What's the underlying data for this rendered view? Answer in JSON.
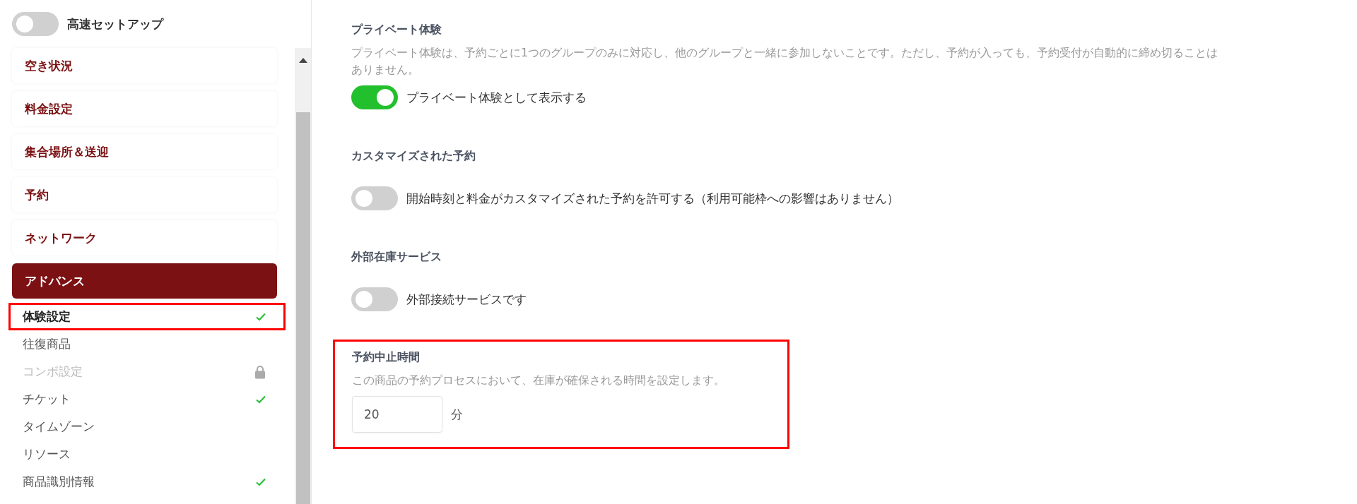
{
  "quick_setup": {
    "label": "高速セットアップ",
    "on": false
  },
  "nav": [
    {
      "label": "空き状況",
      "selected": false
    },
    {
      "label": "料金設定",
      "selected": false
    },
    {
      "label": "集合場所＆送迎",
      "selected": false
    },
    {
      "label": "予約",
      "selected": false
    },
    {
      "label": "ネットワーク",
      "selected": false
    },
    {
      "label": "アドバンス",
      "selected": true
    }
  ],
  "sub_items": [
    {
      "label": "体験設定",
      "selected": true,
      "checked": true,
      "locked": false,
      "highlighted": true
    },
    {
      "label": "往復商品",
      "selected": false,
      "checked": false,
      "locked": false,
      "highlighted": false
    },
    {
      "label": "コンボ設定",
      "selected": false,
      "checked": false,
      "locked": true,
      "highlighted": false
    },
    {
      "label": "チケット",
      "selected": false,
      "checked": true,
      "locked": false,
      "highlighted": false
    },
    {
      "label": "タイムゾーン",
      "selected": false,
      "checked": false,
      "locked": false,
      "highlighted": false
    },
    {
      "label": "リソース",
      "selected": false,
      "checked": false,
      "locked": false,
      "highlighted": false
    },
    {
      "label": "商品識別情報",
      "selected": false,
      "checked": true,
      "locked": false,
      "highlighted": false
    }
  ],
  "sections": [
    {
      "kind": "toggle",
      "title": "プライベート体験",
      "description": "プライベート体験は、予約ごとに1つのグループのみに対応し、他のグループと一緒に参加しないことです。ただし、予約が入っても、予約受付が自動的に締め切ることはありません。",
      "label": "プライベート体験として表示する",
      "on": true,
      "highlighted": false
    },
    {
      "kind": "toggle",
      "title": "カスタマイズされた予約",
      "label": "開始時刻と料金がカスタマイズされた予約を許可する（利用可能枠への影響はありません）",
      "on": false,
      "highlighted": false
    },
    {
      "kind": "toggle",
      "title": "外部在庫サービス",
      "label": "外部接続サービスです",
      "on": false,
      "highlighted": false
    },
    {
      "kind": "number",
      "title": "予約中止時間",
      "description": "この商品の予約プロセスにおいて、在庫が確保される時間を設定します。",
      "value": "20",
      "unit": "分",
      "highlighted": true
    }
  ]
}
